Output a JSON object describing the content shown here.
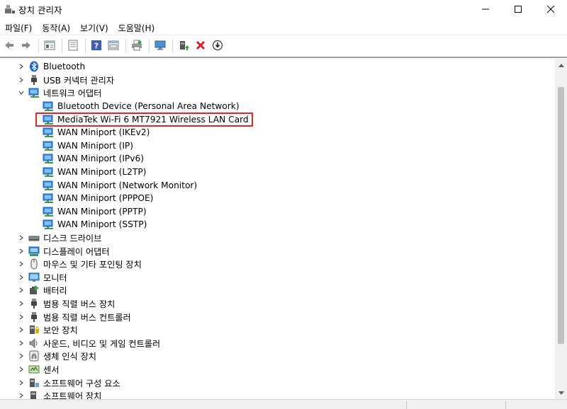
{
  "window": {
    "title": "장치 관리자",
    "controls": {
      "minimize": "—",
      "maximize": "☐",
      "close": "✕"
    }
  },
  "menu": [
    {
      "label": "파일(F)"
    },
    {
      "label": "동작(A)"
    },
    {
      "label": "보기(V)"
    },
    {
      "label": "도움말(H)"
    }
  ],
  "toolbar": {
    "buttons": [
      "back-icon",
      "forward-icon",
      "properties-icon",
      "view-details-icon",
      "help-icon",
      "resources-icon",
      "print-icon",
      "scan-hardware-icon",
      "update-driver-icon",
      "uninstall-icon",
      "disable-icon"
    ]
  },
  "tree": {
    "top_items": [
      {
        "label": "Bluetooth",
        "icon": "bluetooth-icon",
        "expanded": false
      },
      {
        "label": "USB 커넥터 관리자",
        "icon": "usb-icon",
        "expanded": false
      },
      {
        "label": "네트워크 어댑터",
        "icon": "network-adapter-icon",
        "expanded": true
      }
    ],
    "network_children": [
      {
        "label": "Bluetooth Device (Personal Area Network)"
      },
      {
        "label": "MediaTek Wi-Fi 6 MT7921 Wireless LAN Card",
        "selected": true
      },
      {
        "label": "WAN Miniport (IKEv2)"
      },
      {
        "label": "WAN Miniport (IP)"
      },
      {
        "label": "WAN Miniport (IPv6)"
      },
      {
        "label": "WAN Miniport (L2TP)"
      },
      {
        "label": "WAN Miniport (Network Monitor)"
      },
      {
        "label": "WAN Miniport (PPPOE)"
      },
      {
        "label": "WAN Miniport (PPTP)"
      },
      {
        "label": "WAN Miniport (SSTP)"
      }
    ],
    "bottom_items": [
      {
        "label": "디스크 드라이브",
        "icon": "disk-drive-icon"
      },
      {
        "label": "디스플레이 어댑터",
        "icon": "display-adapter-icon"
      },
      {
        "label": "마우스 및 기타 포인팅 장치",
        "icon": "mouse-icon"
      },
      {
        "label": "모니터",
        "icon": "monitor-icon"
      },
      {
        "label": "배터리",
        "icon": "battery-icon"
      },
      {
        "label": "범용 직렬 버스 장치",
        "icon": "usb-device-icon"
      },
      {
        "label": "범용 직렬 버스 컨트롤러",
        "icon": "usb-controller-icon"
      },
      {
        "label": "보안 장치",
        "icon": "security-device-icon"
      },
      {
        "label": "사운드, 비디오 및 게임 컨트롤러",
        "icon": "sound-icon"
      },
      {
        "label": "생체 인식 장치",
        "icon": "biometric-icon"
      },
      {
        "label": "센서",
        "icon": "sensor-icon"
      },
      {
        "label": "소프트웨어 구성 요소",
        "icon": "software-component-icon"
      },
      {
        "label": "소프트웨어 장치",
        "icon": "software-device-icon"
      }
    ]
  },
  "colors": {
    "selection_border": "#e0262b",
    "network_icon": "#2a7fd4"
  }
}
